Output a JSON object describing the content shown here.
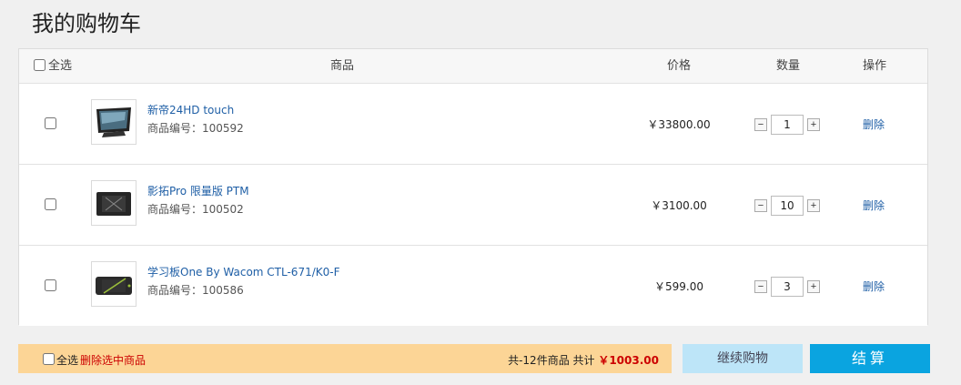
{
  "page": {
    "title": "我的购物车"
  },
  "table": {
    "headers": {
      "select_all": "全选",
      "product": "商品",
      "price": "价格",
      "quantity": "数量",
      "operation": "操作"
    },
    "rows": [
      {
        "name": "新帝24HD touch",
        "sku": "商品编号：100592",
        "price": "￥33800.00",
        "quantity": "1",
        "delete_label": "删除",
        "thumb_icon": "tablet-display-icon"
      },
      {
        "name": "影拓Pro 限量版 PTM",
        "sku": "商品编号：100502",
        "price": "￥3100.00",
        "quantity": "10",
        "delete_label": "删除",
        "thumb_icon": "pen-tablet-icon"
      },
      {
        "name": "学习板One By Wacom CTL-671/K0-F",
        "sku": "商品编号：100586",
        "price": "￥599.00",
        "quantity": "3",
        "delete_label": "删除",
        "thumb_icon": "drawing-tablet-icon"
      }
    ],
    "qty_minus": "−",
    "qty_plus": "+"
  },
  "footer": {
    "select_all": "全选",
    "delete_selected": "删除选中商品",
    "summary_prefix": "共-12件商品 共计 ",
    "total": "￥1003.00",
    "continue_label": "继续购物",
    "checkout_label": "结算"
  },
  "colors": {
    "footer_bg": "#fcd596",
    "checkout_bg": "#0aa4e0",
    "continue_bg": "#bde5f8",
    "link": "#1f5fa6",
    "total": "#cc0000"
  }
}
